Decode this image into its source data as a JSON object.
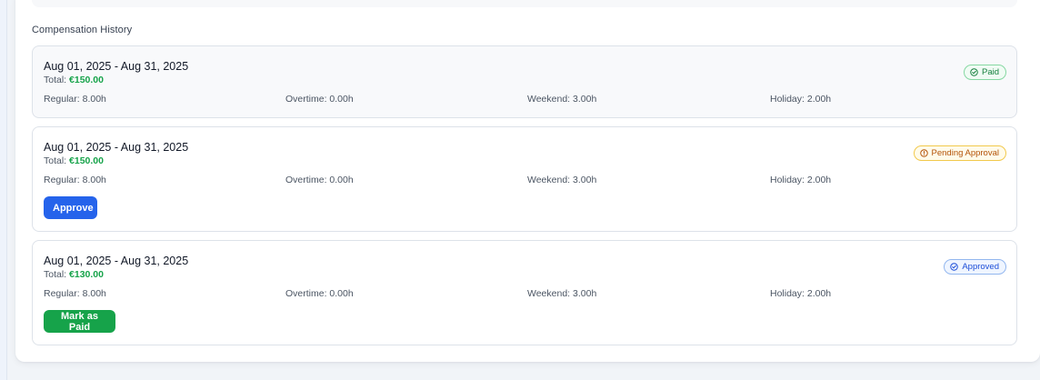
{
  "section_title": "Compensation History",
  "colors": {
    "accent_green": "#16a34a",
    "accent_blue": "#2563eb",
    "pending": "#b45309",
    "approved": "#1d4ed8"
  },
  "records": [
    {
      "period": "Aug 01, 2025 - Aug 31, 2025",
      "total_label": "Total:",
      "total_amount": "€150.00",
      "regular": "Regular: 8.00h",
      "overtime": "Overtime: 0.00h",
      "weekend": "Weekend: 3.00h",
      "holiday": "Holiday: 2.00h",
      "status": "Paid",
      "status_icon": "check-circle-icon"
    },
    {
      "period": "Aug 01, 2025 - Aug 31, 2025",
      "total_label": "Total:",
      "total_amount": "€150.00",
      "regular": "Regular: 8.00h",
      "overtime": "Overtime: 0.00h",
      "weekend": "Weekend: 3.00h",
      "holiday": "Holiday: 2.00h",
      "status": "Pending Approval",
      "status_icon": "alert-circle-icon",
      "action_label": "Approve"
    },
    {
      "period": "Aug 01, 2025 - Aug 31, 2025",
      "total_label": "Total:",
      "total_amount": "€130.00",
      "regular": "Regular: 8.00h",
      "overtime": "Overtime: 0.00h",
      "weekend": "Weekend: 3.00h",
      "holiday": "Holiday: 2.00h",
      "status": "Approved",
      "status_icon": "check-circle-icon",
      "action_label": "Mark as Paid"
    }
  ]
}
